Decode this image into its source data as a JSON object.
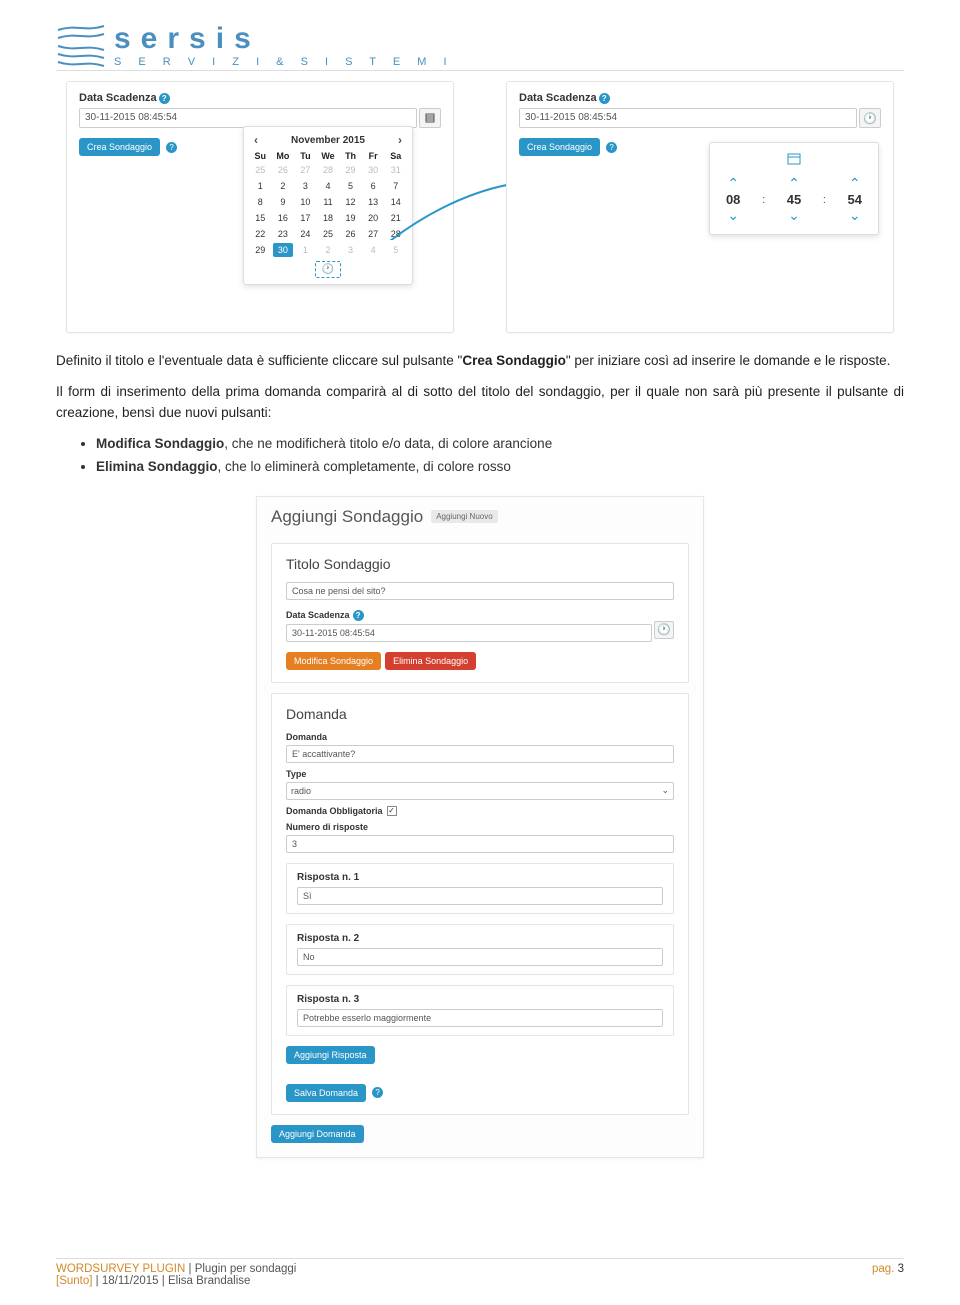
{
  "logo": {
    "word": "sersis",
    "sub": "S E R V I Z I   &   S I S T E M I"
  },
  "shot1": {
    "date_label": "Data Scadenza",
    "date_value": "30-11-2015 08:45:54",
    "btn": "Crea Sondaggio",
    "datepicker": {
      "month": "November 2015",
      "dow": [
        "Su",
        "Mo",
        "Tu",
        "We",
        "Th",
        "Fr",
        "Sa"
      ],
      "rows": [
        [
          "25",
          "26",
          "27",
          "28",
          "29",
          "30",
          "31"
        ],
        [
          "1",
          "2",
          "3",
          "4",
          "5",
          "6",
          "7"
        ],
        [
          "8",
          "9",
          "10",
          "11",
          "12",
          "13",
          "14"
        ],
        [
          "15",
          "16",
          "17",
          "18",
          "19",
          "20",
          "21"
        ],
        [
          "22",
          "23",
          "24",
          "25",
          "26",
          "27",
          "28"
        ],
        [
          "29",
          "30",
          "1",
          "2",
          "3",
          "4",
          "5"
        ]
      ],
      "selected": "30"
    }
  },
  "shot2": {
    "date_label": "Data Scadenza",
    "date_value": "30-11-2015 08:45:54",
    "btn": "Crea Sondaggio",
    "time": {
      "h": "08",
      "m": "45",
      "s": "54"
    }
  },
  "para1": "Definito il titolo e l'eventuale data è sufficiente cliccare sul pulsante \"",
  "para1_bold": "Crea Sondaggio",
  "para1_end": "\" per iniziare così ad inserire le domande e le risposte.",
  "para2": "Il form di inserimento della prima domanda comparirà al di sotto del titolo del sondaggio, per il quale non sarà più presente il pulsante di creazione, bensì due nuovi pulsanti:",
  "bullet1a": "Modifica Sondaggio",
  "bullet1b": ", che ne modificherà titolo e/o data, di colore arancione",
  "bullet2a": "Elimina Sondaggio",
  "bullet2b": ", che lo eliminerà completamente, di colore rosso",
  "shot3": {
    "title": "Aggiungi Sondaggio",
    "badge": "Aggiungi Nuovo",
    "block1": {
      "heading": "Titolo Sondaggio",
      "title_value": "Cosa ne pensi del sito?",
      "date_label": "Data Scadenza",
      "date_value": "30-11-2015 08:45:54",
      "btn_mod": "Modifica Sondaggio",
      "btn_del": "Elimina Sondaggio"
    },
    "block2": {
      "heading": "Domanda",
      "q_label": "Domanda",
      "q_value": "E' accattivante?",
      "type_label": "Type",
      "type_value": "radio",
      "mandatory_label": "Domanda Obbligatoria",
      "numresp_label": "Numero di risposte",
      "numresp_value": "3",
      "resp": [
        {
          "h": "Risposta n. 1",
          "v": "Sì"
        },
        {
          "h": "Risposta n. 2",
          "v": "No"
        },
        {
          "h": "Risposta n. 3",
          "v": "Potrebbe esserlo maggiormente"
        }
      ],
      "btn_addresp": "Aggiungi Risposta",
      "btn_save": "Salva Domanda"
    },
    "btn_addq": "Aggiungi Domanda"
  },
  "footer": {
    "brand": "WORDSURVEY PLUGIN",
    "sep": "|",
    "desc": "Plugin per sondaggi",
    "line2a": "[Sunto]",
    "line2b": "18/11/2015",
    "line2c": "Elisa Brandalise",
    "page_label": "pag.",
    "page_num": "3"
  }
}
